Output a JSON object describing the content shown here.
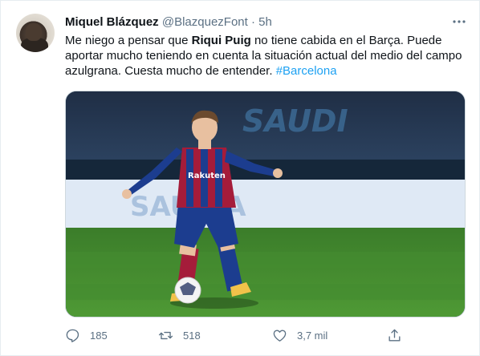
{
  "author": {
    "name": "Miquel Blázquez",
    "handle": "@BlazquezFont",
    "separator": "·",
    "time": "5h"
  },
  "tweet": {
    "text_part1": "Me niego a pensar que ",
    "bold1": "Riqui Puig",
    "text_part2": " no tiene cabida en el Barça. Puede aportar mucho teniendo en cuenta la situación actual del medio del campo azulgrana. Cuesta mucho de entender. ",
    "hashtag": "#Barcelona"
  },
  "media": {
    "banner_top_text": "SAUDI",
    "banner_board_text": "SAUDIA",
    "shirt_text": "Rakuten",
    "accent_color": "#1da1f2",
    "pitch_color": "#3f8a2c"
  },
  "actions": {
    "reply_count": "185",
    "retweet_count": "518",
    "like_count": "3,7 mil",
    "reply_icon": "reply-icon",
    "retweet_icon": "retweet-icon",
    "like_icon": "heart-icon",
    "share_icon": "share-icon"
  }
}
